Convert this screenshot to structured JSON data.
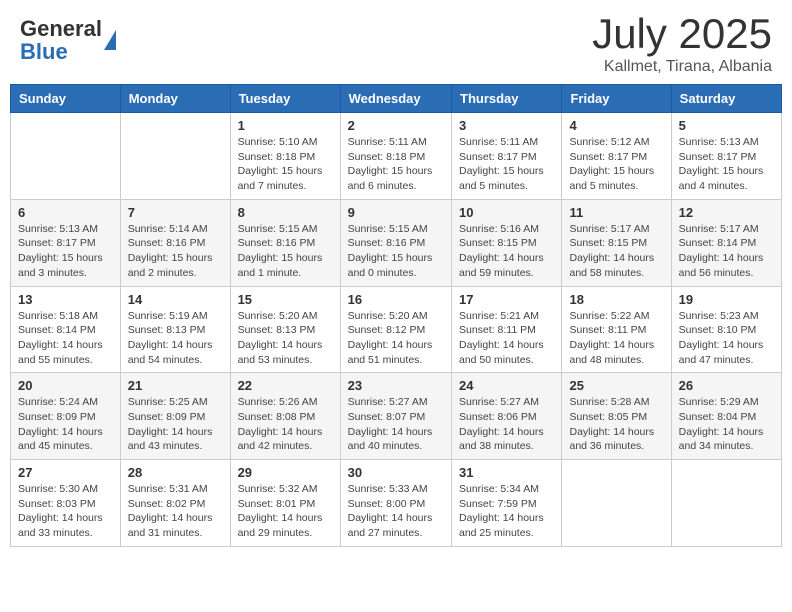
{
  "header": {
    "logo_general": "General",
    "logo_blue": "Blue",
    "month": "July 2025",
    "location": "Kallmet, Tirana, Albania"
  },
  "weekdays": [
    "Sunday",
    "Monday",
    "Tuesday",
    "Wednesday",
    "Thursday",
    "Friday",
    "Saturday"
  ],
  "weeks": [
    [
      {
        "day": "",
        "info": ""
      },
      {
        "day": "",
        "info": ""
      },
      {
        "day": "1",
        "info": "Sunrise: 5:10 AM\nSunset: 8:18 PM\nDaylight: 15 hours and 7 minutes."
      },
      {
        "day": "2",
        "info": "Sunrise: 5:11 AM\nSunset: 8:18 PM\nDaylight: 15 hours and 6 minutes."
      },
      {
        "day": "3",
        "info": "Sunrise: 5:11 AM\nSunset: 8:17 PM\nDaylight: 15 hours and 5 minutes."
      },
      {
        "day": "4",
        "info": "Sunrise: 5:12 AM\nSunset: 8:17 PM\nDaylight: 15 hours and 5 minutes."
      },
      {
        "day": "5",
        "info": "Sunrise: 5:13 AM\nSunset: 8:17 PM\nDaylight: 15 hours and 4 minutes."
      }
    ],
    [
      {
        "day": "6",
        "info": "Sunrise: 5:13 AM\nSunset: 8:17 PM\nDaylight: 15 hours and 3 minutes."
      },
      {
        "day": "7",
        "info": "Sunrise: 5:14 AM\nSunset: 8:16 PM\nDaylight: 15 hours and 2 minutes."
      },
      {
        "day": "8",
        "info": "Sunrise: 5:15 AM\nSunset: 8:16 PM\nDaylight: 15 hours and 1 minute."
      },
      {
        "day": "9",
        "info": "Sunrise: 5:15 AM\nSunset: 8:16 PM\nDaylight: 15 hours and 0 minutes."
      },
      {
        "day": "10",
        "info": "Sunrise: 5:16 AM\nSunset: 8:15 PM\nDaylight: 14 hours and 59 minutes."
      },
      {
        "day": "11",
        "info": "Sunrise: 5:17 AM\nSunset: 8:15 PM\nDaylight: 14 hours and 58 minutes."
      },
      {
        "day": "12",
        "info": "Sunrise: 5:17 AM\nSunset: 8:14 PM\nDaylight: 14 hours and 56 minutes."
      }
    ],
    [
      {
        "day": "13",
        "info": "Sunrise: 5:18 AM\nSunset: 8:14 PM\nDaylight: 14 hours and 55 minutes."
      },
      {
        "day": "14",
        "info": "Sunrise: 5:19 AM\nSunset: 8:13 PM\nDaylight: 14 hours and 54 minutes."
      },
      {
        "day": "15",
        "info": "Sunrise: 5:20 AM\nSunset: 8:13 PM\nDaylight: 14 hours and 53 minutes."
      },
      {
        "day": "16",
        "info": "Sunrise: 5:20 AM\nSunset: 8:12 PM\nDaylight: 14 hours and 51 minutes."
      },
      {
        "day": "17",
        "info": "Sunrise: 5:21 AM\nSunset: 8:11 PM\nDaylight: 14 hours and 50 minutes."
      },
      {
        "day": "18",
        "info": "Sunrise: 5:22 AM\nSunset: 8:11 PM\nDaylight: 14 hours and 48 minutes."
      },
      {
        "day": "19",
        "info": "Sunrise: 5:23 AM\nSunset: 8:10 PM\nDaylight: 14 hours and 47 minutes."
      }
    ],
    [
      {
        "day": "20",
        "info": "Sunrise: 5:24 AM\nSunset: 8:09 PM\nDaylight: 14 hours and 45 minutes."
      },
      {
        "day": "21",
        "info": "Sunrise: 5:25 AM\nSunset: 8:09 PM\nDaylight: 14 hours and 43 minutes."
      },
      {
        "day": "22",
        "info": "Sunrise: 5:26 AM\nSunset: 8:08 PM\nDaylight: 14 hours and 42 minutes."
      },
      {
        "day": "23",
        "info": "Sunrise: 5:27 AM\nSunset: 8:07 PM\nDaylight: 14 hours and 40 minutes."
      },
      {
        "day": "24",
        "info": "Sunrise: 5:27 AM\nSunset: 8:06 PM\nDaylight: 14 hours and 38 minutes."
      },
      {
        "day": "25",
        "info": "Sunrise: 5:28 AM\nSunset: 8:05 PM\nDaylight: 14 hours and 36 minutes."
      },
      {
        "day": "26",
        "info": "Sunrise: 5:29 AM\nSunset: 8:04 PM\nDaylight: 14 hours and 34 minutes."
      }
    ],
    [
      {
        "day": "27",
        "info": "Sunrise: 5:30 AM\nSunset: 8:03 PM\nDaylight: 14 hours and 33 minutes."
      },
      {
        "day": "28",
        "info": "Sunrise: 5:31 AM\nSunset: 8:02 PM\nDaylight: 14 hours and 31 minutes."
      },
      {
        "day": "29",
        "info": "Sunrise: 5:32 AM\nSunset: 8:01 PM\nDaylight: 14 hours and 29 minutes."
      },
      {
        "day": "30",
        "info": "Sunrise: 5:33 AM\nSunset: 8:00 PM\nDaylight: 14 hours and 27 minutes."
      },
      {
        "day": "31",
        "info": "Sunrise: 5:34 AM\nSunset: 7:59 PM\nDaylight: 14 hours and 25 minutes."
      },
      {
        "day": "",
        "info": ""
      },
      {
        "day": "",
        "info": ""
      }
    ]
  ]
}
